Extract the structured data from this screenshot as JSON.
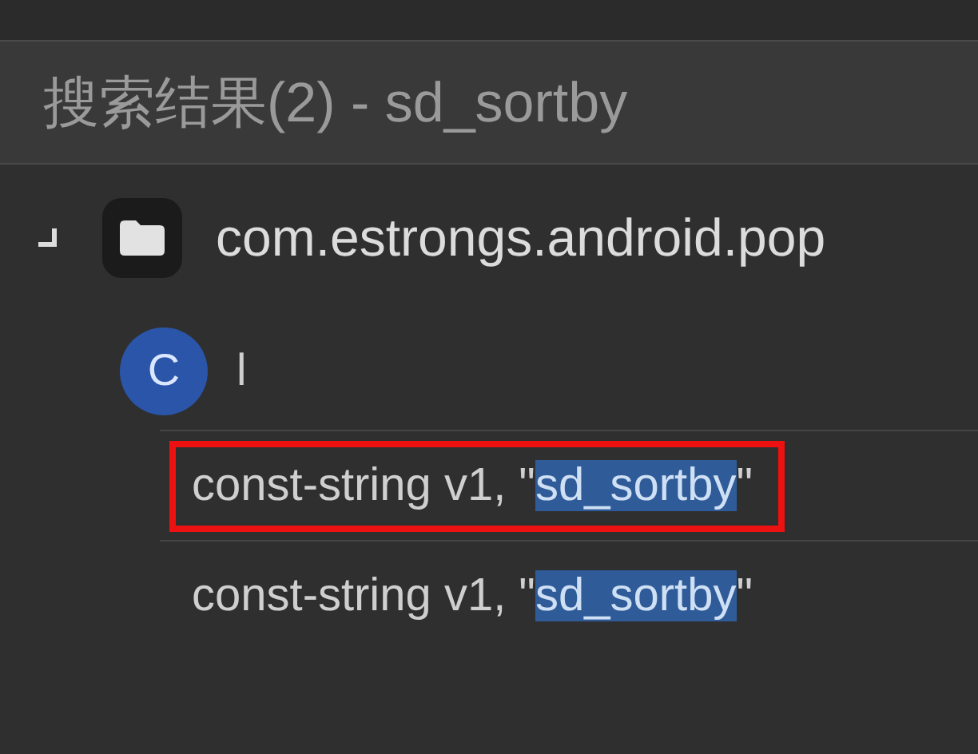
{
  "header": {
    "title": "搜索结果(2) - sd_sortby"
  },
  "tree": {
    "name": "com.estrongs.android.pop",
    "expanded": true,
    "children": [
      {
        "badge": "C",
        "name": "l",
        "children": [
          {
            "before": "const-string v1, \"",
            "match": "sd_sortby",
            "after": "\"",
            "outlined": true
          },
          {
            "before": "const-string v1, \"",
            "match": "sd_sortby",
            "after": "\"",
            "outlined": false
          }
        ]
      }
    ]
  }
}
